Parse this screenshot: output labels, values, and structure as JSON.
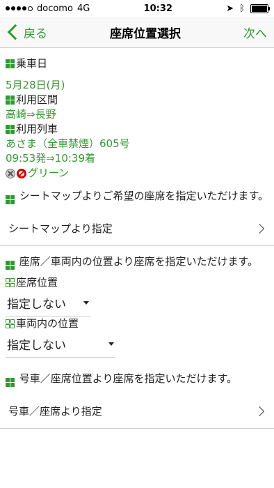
{
  "status_bar": {
    "carrier": "docomo",
    "network": "4G",
    "time": "10:32"
  },
  "nav": {
    "back_label": "戻る",
    "title": "座席位置選択",
    "next_label": "次へ"
  },
  "ride": {
    "date_heading": "乗車日",
    "date": "5月28日(月)",
    "section_heading": "利用区間",
    "section": "高崎⇒長野",
    "train_heading": "利用列車",
    "train": "あさま（全車禁煙）605号",
    "times": "09:53発⇒10:39着",
    "car_class": "グリーン"
  },
  "seatmap": {
    "text": "シートマップよりご希望の座席を指定いただけます。",
    "link_label": "シートマップより指定"
  },
  "position": {
    "text": "座席／車両内の位置より座席を指定いただけます。",
    "seat_heading": "座席位置",
    "seat_value": "指定しない",
    "car_heading": "車両内の位置",
    "car_value": "指定しない"
  },
  "car_seat": {
    "text": "号車／座席位置より座席を指定いただけます。",
    "link_label": "号車／座席より指定"
  }
}
